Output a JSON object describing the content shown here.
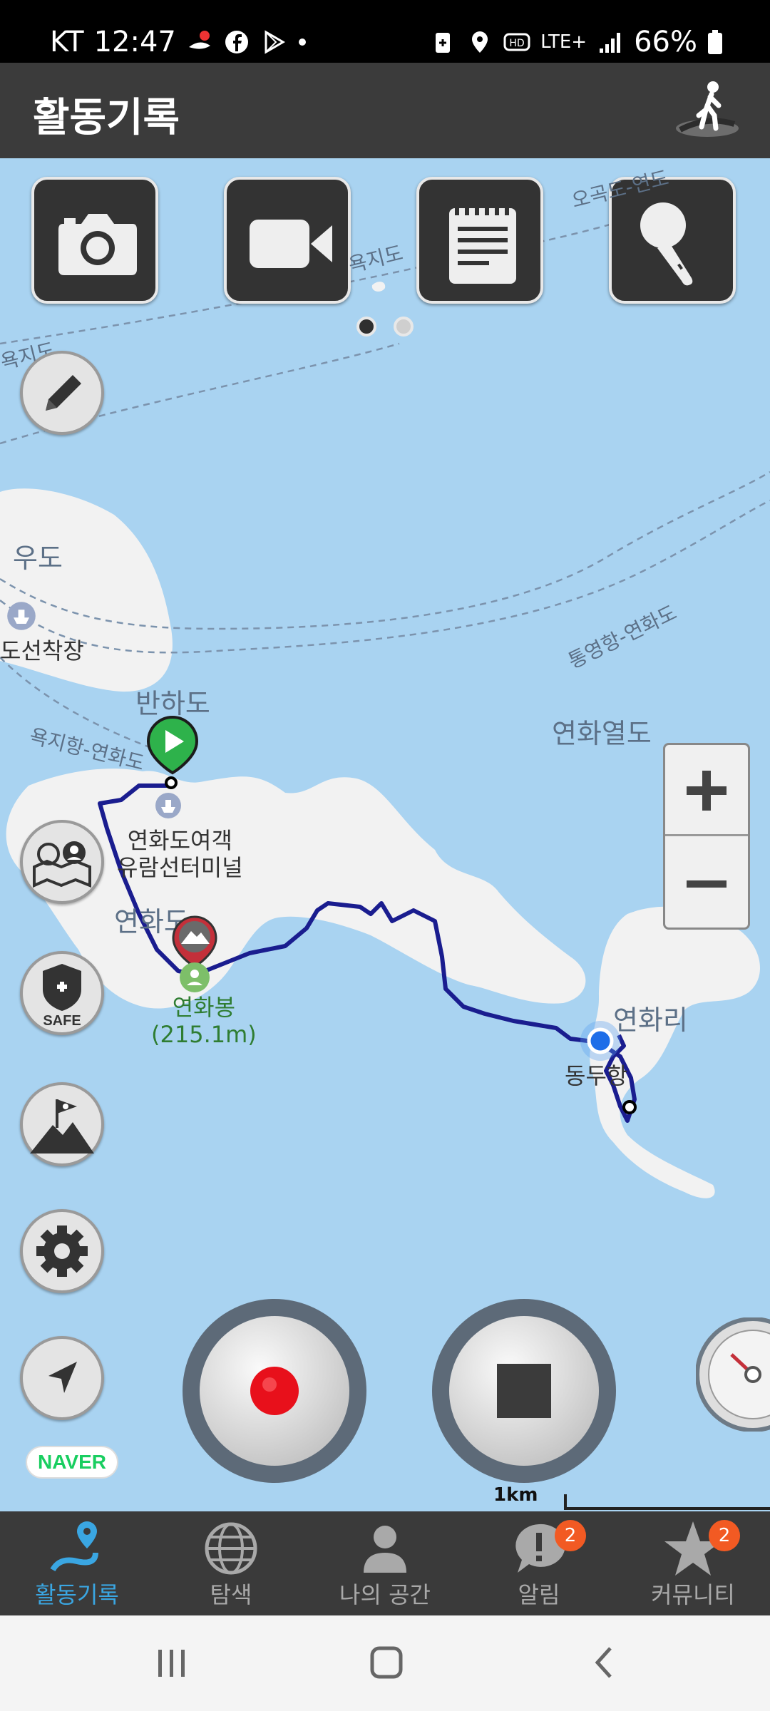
{
  "status_bar": {
    "carrier": "KT",
    "time": "12:47",
    "network": "LTE+",
    "battery": "66%"
  },
  "header": {
    "title": "활동기록"
  },
  "map": {
    "labels": {
      "ogokdo": "오곡도-연도",
      "yokjido_a": "욕지도",
      "yokjido_b": "욕지도",
      "udo": "우도",
      "ferry_dock": "도선착장",
      "banhado": "반하도",
      "tongyeong_route": "통영항-연화도",
      "yeonhwa_archipelago": "연화열도",
      "yokji_route": "욕지항-연화도",
      "terminal_line1": "연화도여객",
      "terminal_line2": "유람선터미널",
      "yeonhwado": "연화도",
      "peak_name": "연화봉",
      "peak_height": "(215.1m)",
      "yeonhwari": "연화리",
      "dongduhang": "동두항"
    },
    "scale_label": "1km",
    "provider": "NAVER"
  },
  "toolbar": {
    "camera_icon": "camera-icon",
    "video_icon": "video-icon",
    "note_icon": "notepad-icon",
    "mic_icon": "microphone-icon",
    "page_count": 2,
    "active_page": 1
  },
  "tabs": [
    {
      "label": "활동기록",
      "icon": "route-pin-icon",
      "active": true
    },
    {
      "label": "탐색",
      "icon": "globe-icon"
    },
    {
      "label": "나의 공간",
      "icon": "person-icon"
    },
    {
      "label": "알림",
      "icon": "alert-bubble-icon",
      "badge": "2"
    },
    {
      "label": "커뮤니티",
      "icon": "star-icon",
      "badge": "2"
    }
  ],
  "colors": {
    "map_water": "#a9d3f1",
    "land": "#f2f2f2",
    "track": "#1a1d8f",
    "active_tab": "#3aa6e2",
    "badge": "#f25a23",
    "record": "#e8101b"
  }
}
